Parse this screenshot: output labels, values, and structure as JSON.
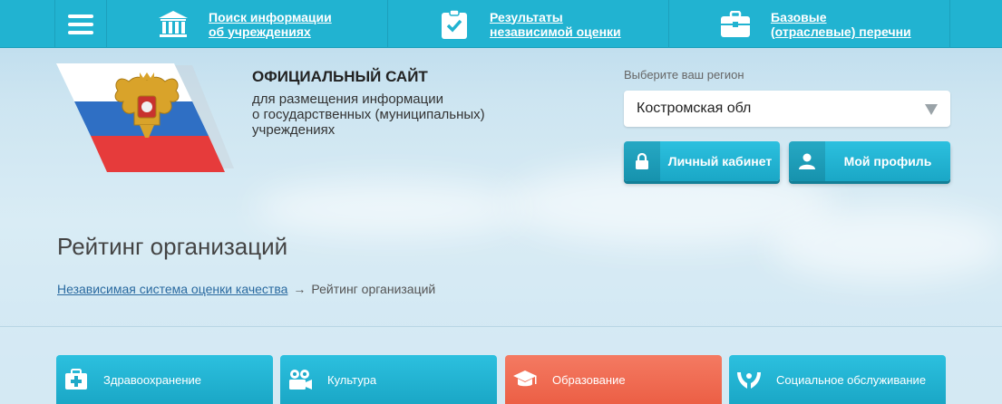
{
  "nav": {
    "menu_icon": "hamburger-icon",
    "items": [
      {
        "icon": "institution-icon",
        "line1": "Поиск информации",
        "line2": "об учреждениях"
      },
      {
        "icon": "clipboard-check-icon",
        "line1": "Результаты",
        "line2": "независимой оценки"
      },
      {
        "icon": "briefcase-icon",
        "line1": "Базовые",
        "line2": "(отраслевые) перечни"
      }
    ]
  },
  "site": {
    "title": "ОФИЦИАЛЬНЫЙ САЙТ",
    "sub1": "для размещения информации",
    "sub2": "о государственных (муниципальных)",
    "sub3": "учреждениях"
  },
  "region": {
    "label": "Выберите ваш регион",
    "selected": "Костромская обл"
  },
  "buttons": {
    "cabinet": "Личный кабинет",
    "profile": "Мой профиль"
  },
  "page": {
    "title": "Рейтинг организаций"
  },
  "breadcrumb": {
    "link": "Независимая система оценки качества",
    "separator": "→",
    "current": "Рейтинг организаций"
  },
  "categories": [
    {
      "label": "Здравоохранение",
      "icon": "medkit-icon"
    },
    {
      "label": "Культура",
      "icon": "camera-icon"
    },
    {
      "label": "Образование",
      "icon": "graduation-cap-icon"
    },
    {
      "label": "Социальное обслуживание",
      "icon": "hands-icon"
    }
  ],
  "colors": {
    "primary": "#21b3d1",
    "active": "#ec5f45"
  }
}
